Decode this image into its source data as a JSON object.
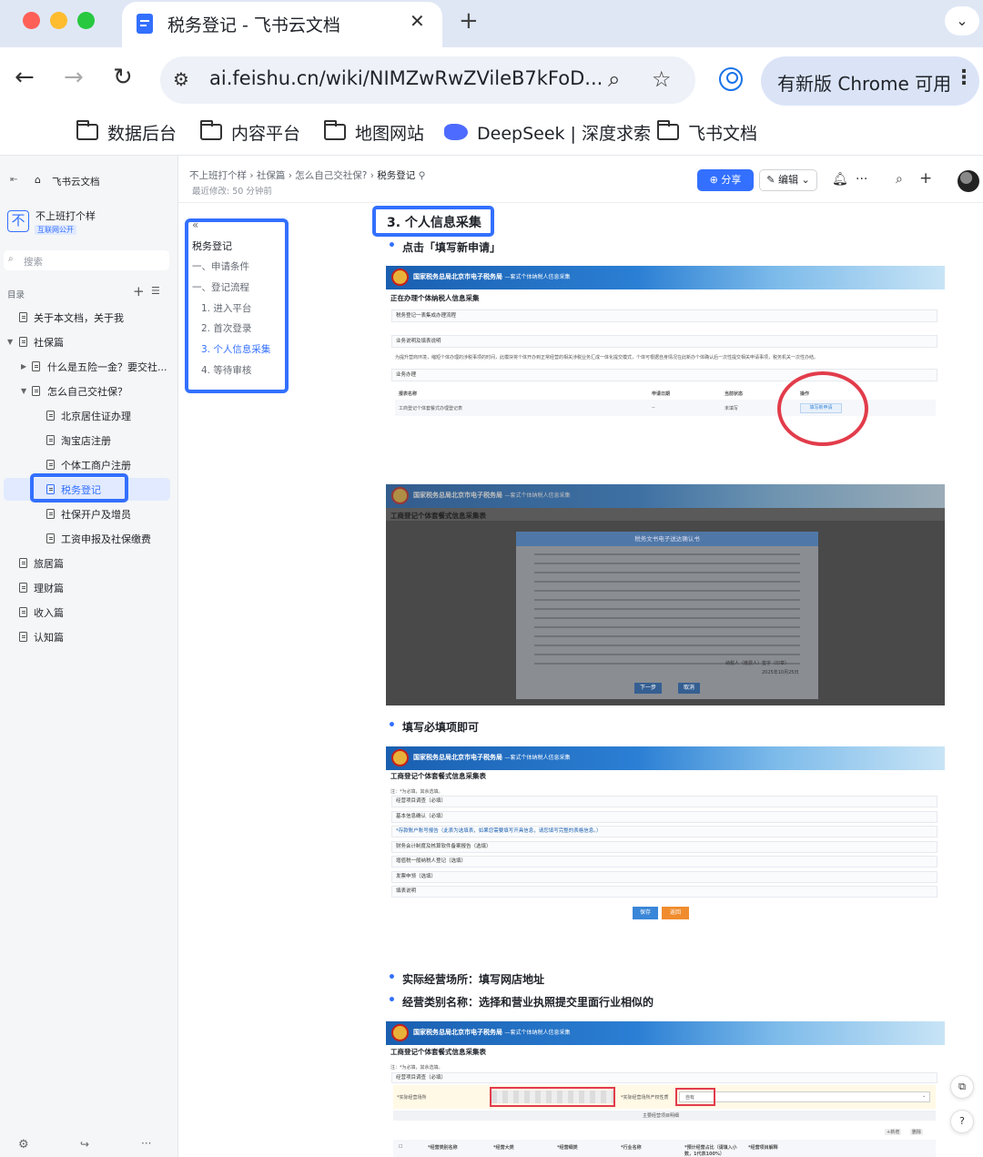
{
  "browser": {
    "tab_title": "税务登记 - 飞书云文档",
    "url": "ai.feishu.cn/wiki/NIMZwRwZVileB7kFoD...",
    "update_label": "有新版 Chrome 可用",
    "bookmarks": [
      {
        "label": "数据后台",
        "icon": "folder-icon"
      },
      {
        "label": "内容平台",
        "icon": "folder-icon"
      },
      {
        "label": "地图网站",
        "icon": "folder-icon"
      },
      {
        "label": "DeepSeek | 深度求索",
        "icon": "deepseek-icon"
      },
      {
        "label": "飞书文档",
        "icon": "folder-icon"
      }
    ]
  },
  "sidebar": {
    "home_label": "飞书云文档",
    "space_name": "不上班打个样",
    "space_badge": "互联网公开",
    "search_placeholder": "搜索",
    "toc_label": "目录",
    "items": [
      {
        "label": "关于本文档，关于我"
      },
      {
        "label": "社保篇"
      },
      {
        "label": "什么是五险一金？要交社..."
      },
      {
        "label": "怎么自己交社保？"
      },
      {
        "label": "北京居住证办理"
      },
      {
        "label": "淘宝店注册"
      },
      {
        "label": "个体工商户注册"
      },
      {
        "label": "税务登记",
        "active": true
      },
      {
        "label": "社保开户及增员"
      },
      {
        "label": "工资申报及社保缴费"
      },
      {
        "label": "旅居篇"
      },
      {
        "label": "理财篇"
      },
      {
        "label": "收入篇"
      },
      {
        "label": "认知篇"
      }
    ]
  },
  "header": {
    "breadcrumb": [
      "不上班打个样",
      "社保篇",
      "怎么自己交社保?",
      "税务登记"
    ],
    "last_modified": "最近修改: 50 分钟前",
    "share_label": "分享",
    "edit_label": "编辑"
  },
  "outline": {
    "items": [
      "税务登记",
      "一、申请条件",
      "一、登记流程",
      "1. 进入平台",
      "2. 首次登录",
      "3. 个人信息采集",
      "4. 等待审核"
    ],
    "active_index": 5
  },
  "content": {
    "heading": "3. 个人信息采集",
    "bullets": [
      "点击「填写新申请」",
      "填写必填项即可",
      "实际经营场所：填写网店地址",
      "经营类别名称：选择和营业执照提交里面行业相似的"
    ],
    "site_banner": "国家税务总局北京市电子税务局",
    "site_banner_sub": "—套式个体纳税人信息采集",
    "shot1": {
      "title": "正在办理个体纳税人信息采集",
      "rows": [
        "税务登记一表集成办理流程",
        "业务说明及填表说明",
        "业务办理"
      ],
      "note": "为提升营商环境，缩短个体办理的涉税事项的时间，此模块将个体开办到正常经营的相关涉税业务汇成一体化提交模式，个体可根据自身情况在此新办个体确认后一次性提交相关申请事项，税务机关一次性办结。",
      "cols": [
        "报表名称",
        "申请日期",
        "当前状态",
        "操作"
      ],
      "record": [
        "工商登记个体套餐式办理登记表",
        "--",
        "未填写"
      ],
      "action": "填写新申请"
    },
    "shot2": {
      "title": "工商登记个体套餐式信息采集表",
      "dialog_title": "税务文书电子送达确认书",
      "dialog_signer": "纳税人（缴费人）签字（印章）",
      "dialog_date": "2025年10月25日",
      "next": "下一步",
      "cancel": "取消"
    },
    "shot3": {
      "title": "工商登记个体套餐式信息采集表",
      "note": "注：*为必填，其余选填。",
      "rows": [
        "经营项目调查（必填）",
        "基本信息确认（必填）",
        "*存款账户账号报告（此表为选填表，如果您需要填写开具信息，请您填写完整的表格信息。）",
        "财务会计制度及核算软件备案报告（选填）",
        "增值税一般纳税人登记（选填）",
        "发票申领（选填）",
        "填表说明"
      ],
      "save": "保存",
      "back": "返回"
    },
    "shot4": {
      "title": "工商登记个体套餐式信息采集表",
      "note": "注：*为必填，其余选填。",
      "row": "经营项目调查（必填）",
      "field1": "*实际经营场所",
      "field2": "*实际经营场所产权性质",
      "field2_value": "自有",
      "subhead": "主要经营项目明细",
      "add": "+新增",
      "del": "删除",
      "cols": [
        "*经营类别名称",
        "*经营大类",
        "*经营细类",
        "*行业名称",
        "*预计经营占比（请填入小数，1代表100%）",
        "*经营项目解释"
      ]
    }
  }
}
